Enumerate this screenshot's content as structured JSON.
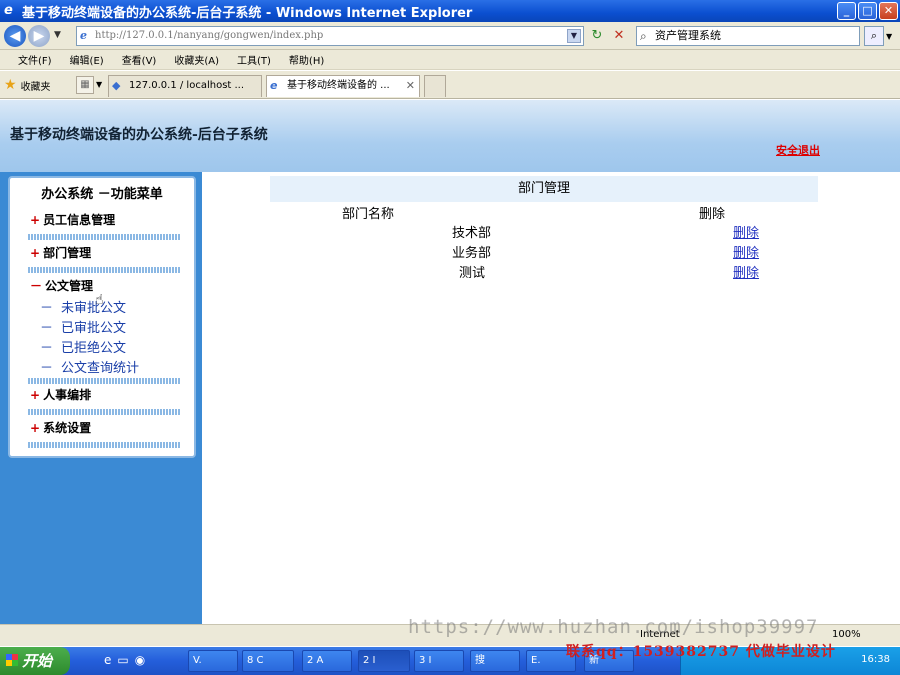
{
  "window": {
    "title": "基于移动终端设备的办公系统-后台子系统 - Windows Internet Explorer"
  },
  "address_bar": {
    "url": "http://127.0.0.1/nanyang/gongwen/index.php",
    "search_placeholder": "资产管理系统"
  },
  "menubar": {
    "items": [
      "文件(F)",
      "编辑(E)",
      "查看(V)",
      "收藏夹(A)",
      "工具(T)",
      "帮助(H)"
    ]
  },
  "favbar": {
    "favorites_label": "收藏夹",
    "tabs": [
      {
        "label": "127.0.0.1 / localhost ..."
      },
      {
        "label": "基于移动终端设备的 ..."
      }
    ]
  },
  "page": {
    "header_title": "基于移动终端设备的办公系统-后台子系统",
    "logout_label": "安全退出"
  },
  "side_menu": {
    "title": "办公系统 －功能菜单",
    "groups": [
      {
        "sign": "+",
        "label": "员工信息管理"
      },
      {
        "sign": "+",
        "label": "部门管理"
      },
      {
        "sign": "－",
        "label": "公文管理",
        "items": [
          "未审批公文",
          "已审批公文",
          "已拒绝公文",
          "公文查询统计"
        ]
      },
      {
        "sign": "+",
        "label": "人事编排"
      },
      {
        "sign": "+",
        "label": "系统设置"
      }
    ]
  },
  "dept_table": {
    "title": "部门管理",
    "columns": [
      "部门名称",
      "删除"
    ],
    "rows": [
      {
        "name": "技术部",
        "action": "删除"
      },
      {
        "name": "业务部",
        "action": "删除"
      },
      {
        "name": "测试",
        "action": "删除"
      }
    ]
  },
  "statusbar": {
    "zone": "Internet",
    "zoom": "100%"
  },
  "taskbar": {
    "start_label": "开始",
    "buttons": [
      "V.",
      "8 C",
      "2 A",
      "2 I",
      "3 I",
      "搜",
      "E.",
      "新"
    ],
    "clock": "16:38"
  },
  "overlay": {
    "watermark": "https://www.huzhan.com/ishop39997",
    "contact": "联系qq：1539382737 代做毕业设计"
  }
}
